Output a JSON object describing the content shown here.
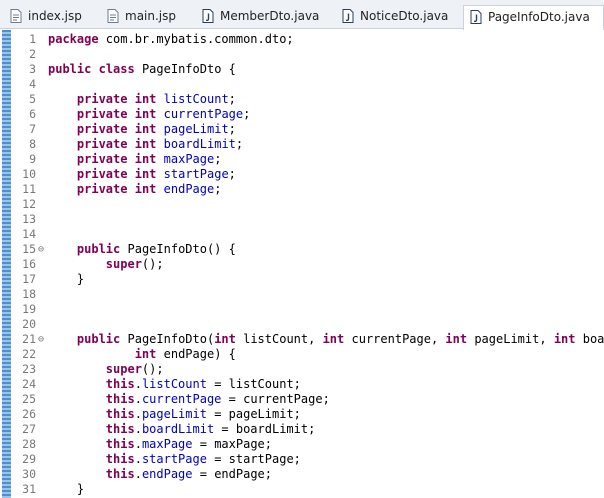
{
  "tabs": [
    {
      "label": "index.jsp",
      "icon": "jsp-file-icon",
      "active": false
    },
    {
      "label": "main.jsp",
      "icon": "jsp-file-icon",
      "active": false
    },
    {
      "label": "MemberDto.java",
      "icon": "java-file-icon",
      "active": false
    },
    {
      "label": "NoticeDto.java",
      "icon": "java-file-icon",
      "active": false
    },
    {
      "label": "PageInfoDto.java",
      "icon": "java-file-icon",
      "active": true
    }
  ],
  "editor": {
    "lines": [
      {
        "n": "1",
        "tokens": [
          [
            "kw",
            "package"
          ],
          [
            "p",
            " com.br.mybatis.common.dto;"
          ]
        ]
      },
      {
        "n": "2",
        "tokens": []
      },
      {
        "n": "3",
        "tokens": [
          [
            "kw",
            "public"
          ],
          [
            "p",
            " "
          ],
          [
            "kw",
            "class"
          ],
          [
            "p",
            " PageInfoDto {"
          ]
        ]
      },
      {
        "n": "4",
        "tokens": []
      },
      {
        "n": "5",
        "tokens": [
          [
            "p",
            "    "
          ],
          [
            "kw",
            "private"
          ],
          [
            "p",
            " "
          ],
          [
            "kw",
            "int"
          ],
          [
            "p",
            " "
          ],
          [
            "f",
            "listCount"
          ],
          [
            "p",
            ";"
          ]
        ]
      },
      {
        "n": "6",
        "tokens": [
          [
            "p",
            "    "
          ],
          [
            "kw",
            "private"
          ],
          [
            "p",
            " "
          ],
          [
            "kw",
            "int"
          ],
          [
            "p",
            " "
          ],
          [
            "f",
            "currentPage"
          ],
          [
            "p",
            ";"
          ]
        ]
      },
      {
        "n": "7",
        "tokens": [
          [
            "p",
            "    "
          ],
          [
            "kw",
            "private"
          ],
          [
            "p",
            " "
          ],
          [
            "kw",
            "int"
          ],
          [
            "p",
            " "
          ],
          [
            "f",
            "pageLimit"
          ],
          [
            "p",
            ";"
          ]
        ]
      },
      {
        "n": "8",
        "tokens": [
          [
            "p",
            "    "
          ],
          [
            "kw",
            "private"
          ],
          [
            "p",
            " "
          ],
          [
            "kw",
            "int"
          ],
          [
            "p",
            " "
          ],
          [
            "f",
            "boardLimit"
          ],
          [
            "p",
            ";"
          ]
        ]
      },
      {
        "n": "9",
        "tokens": [
          [
            "p",
            "    "
          ],
          [
            "kw",
            "private"
          ],
          [
            "p",
            " "
          ],
          [
            "kw",
            "int"
          ],
          [
            "p",
            " "
          ],
          [
            "f",
            "maxPage"
          ],
          [
            "p",
            ";"
          ]
        ]
      },
      {
        "n": "10",
        "tokens": [
          [
            "p",
            "    "
          ],
          [
            "kw",
            "private"
          ],
          [
            "p",
            " "
          ],
          [
            "kw",
            "int"
          ],
          [
            "p",
            " "
          ],
          [
            "f",
            "startPage"
          ],
          [
            "p",
            ";"
          ]
        ]
      },
      {
        "n": "11",
        "tokens": [
          [
            "p",
            "    "
          ],
          [
            "kw",
            "private"
          ],
          [
            "p",
            " "
          ],
          [
            "kw",
            "int"
          ],
          [
            "p",
            " "
          ],
          [
            "f",
            "endPage"
          ],
          [
            "p",
            ";"
          ]
        ]
      },
      {
        "n": "12",
        "tokens": []
      },
      {
        "n": "13",
        "tokens": []
      },
      {
        "n": "14",
        "tokens": []
      },
      {
        "n": "15",
        "fold": "⊖",
        "tokens": [
          [
            "p",
            "    "
          ],
          [
            "kw",
            "public"
          ],
          [
            "p",
            " PageInfoDto() {"
          ]
        ]
      },
      {
        "n": "16",
        "tokens": [
          [
            "p",
            "        "
          ],
          [
            "kw",
            "super"
          ],
          [
            "p",
            "();"
          ]
        ]
      },
      {
        "n": "17",
        "tokens": [
          [
            "p",
            "    }"
          ]
        ]
      },
      {
        "n": "18",
        "tokens": []
      },
      {
        "n": "19",
        "tokens": []
      },
      {
        "n": "20",
        "tokens": []
      },
      {
        "n": "21",
        "fold": "⊖",
        "tokens": [
          [
            "p",
            "    "
          ],
          [
            "kw",
            "public"
          ],
          [
            "p",
            " PageInfoDto("
          ],
          [
            "kw",
            "int"
          ],
          [
            "p",
            " listCount, "
          ],
          [
            "kw",
            "int"
          ],
          [
            "p",
            " currentPage, "
          ],
          [
            "kw",
            "int"
          ],
          [
            "p",
            " pageLimit, "
          ],
          [
            "kw",
            "int"
          ],
          [
            "p",
            " boardLi"
          ]
        ]
      },
      {
        "n": "22",
        "tokens": [
          [
            "p",
            "            "
          ],
          [
            "kw",
            "int"
          ],
          [
            "p",
            " endPage) {"
          ]
        ]
      },
      {
        "n": "23",
        "tokens": [
          [
            "p",
            "        "
          ],
          [
            "kw",
            "super"
          ],
          [
            "p",
            "();"
          ]
        ]
      },
      {
        "n": "24",
        "tokens": [
          [
            "p",
            "        "
          ],
          [
            "kw",
            "this"
          ],
          [
            "p",
            "."
          ],
          [
            "f",
            "listCount"
          ],
          [
            "p",
            " = listCount;"
          ]
        ]
      },
      {
        "n": "25",
        "tokens": [
          [
            "p",
            "        "
          ],
          [
            "kw",
            "this"
          ],
          [
            "p",
            "."
          ],
          [
            "f",
            "currentPage"
          ],
          [
            "p",
            " = currentPage;"
          ]
        ]
      },
      {
        "n": "26",
        "tokens": [
          [
            "p",
            "        "
          ],
          [
            "kw",
            "this"
          ],
          [
            "p",
            "."
          ],
          [
            "f",
            "pageLimit"
          ],
          [
            "p",
            " = pageLimit;"
          ]
        ]
      },
      {
        "n": "27",
        "tokens": [
          [
            "p",
            "        "
          ],
          [
            "kw",
            "this"
          ],
          [
            "p",
            "."
          ],
          [
            "f",
            "boardLimit"
          ],
          [
            "p",
            " = boardLimit;"
          ]
        ]
      },
      {
        "n": "28",
        "tokens": [
          [
            "p",
            "        "
          ],
          [
            "kw",
            "this"
          ],
          [
            "p",
            "."
          ],
          [
            "f",
            "maxPage"
          ],
          [
            "p",
            " = maxPage;"
          ]
        ]
      },
      {
        "n": "29",
        "tokens": [
          [
            "p",
            "        "
          ],
          [
            "kw",
            "this"
          ],
          [
            "p",
            "."
          ],
          [
            "f",
            "startPage"
          ],
          [
            "p",
            " = startPage;"
          ]
        ]
      },
      {
        "n": "30",
        "tokens": [
          [
            "p",
            "        "
          ],
          [
            "kw",
            "this"
          ],
          [
            "p",
            "."
          ],
          [
            "f",
            "endPage"
          ],
          [
            "p",
            " = endPage;"
          ]
        ]
      },
      {
        "n": "31",
        "tokens": [
          [
            "p",
            "    }"
          ]
        ]
      }
    ]
  },
  "colors": {
    "keyword": "#7f0055",
    "field": "#0000c0",
    "line_number": "#787878",
    "change_bar": "#4f8fcf"
  }
}
